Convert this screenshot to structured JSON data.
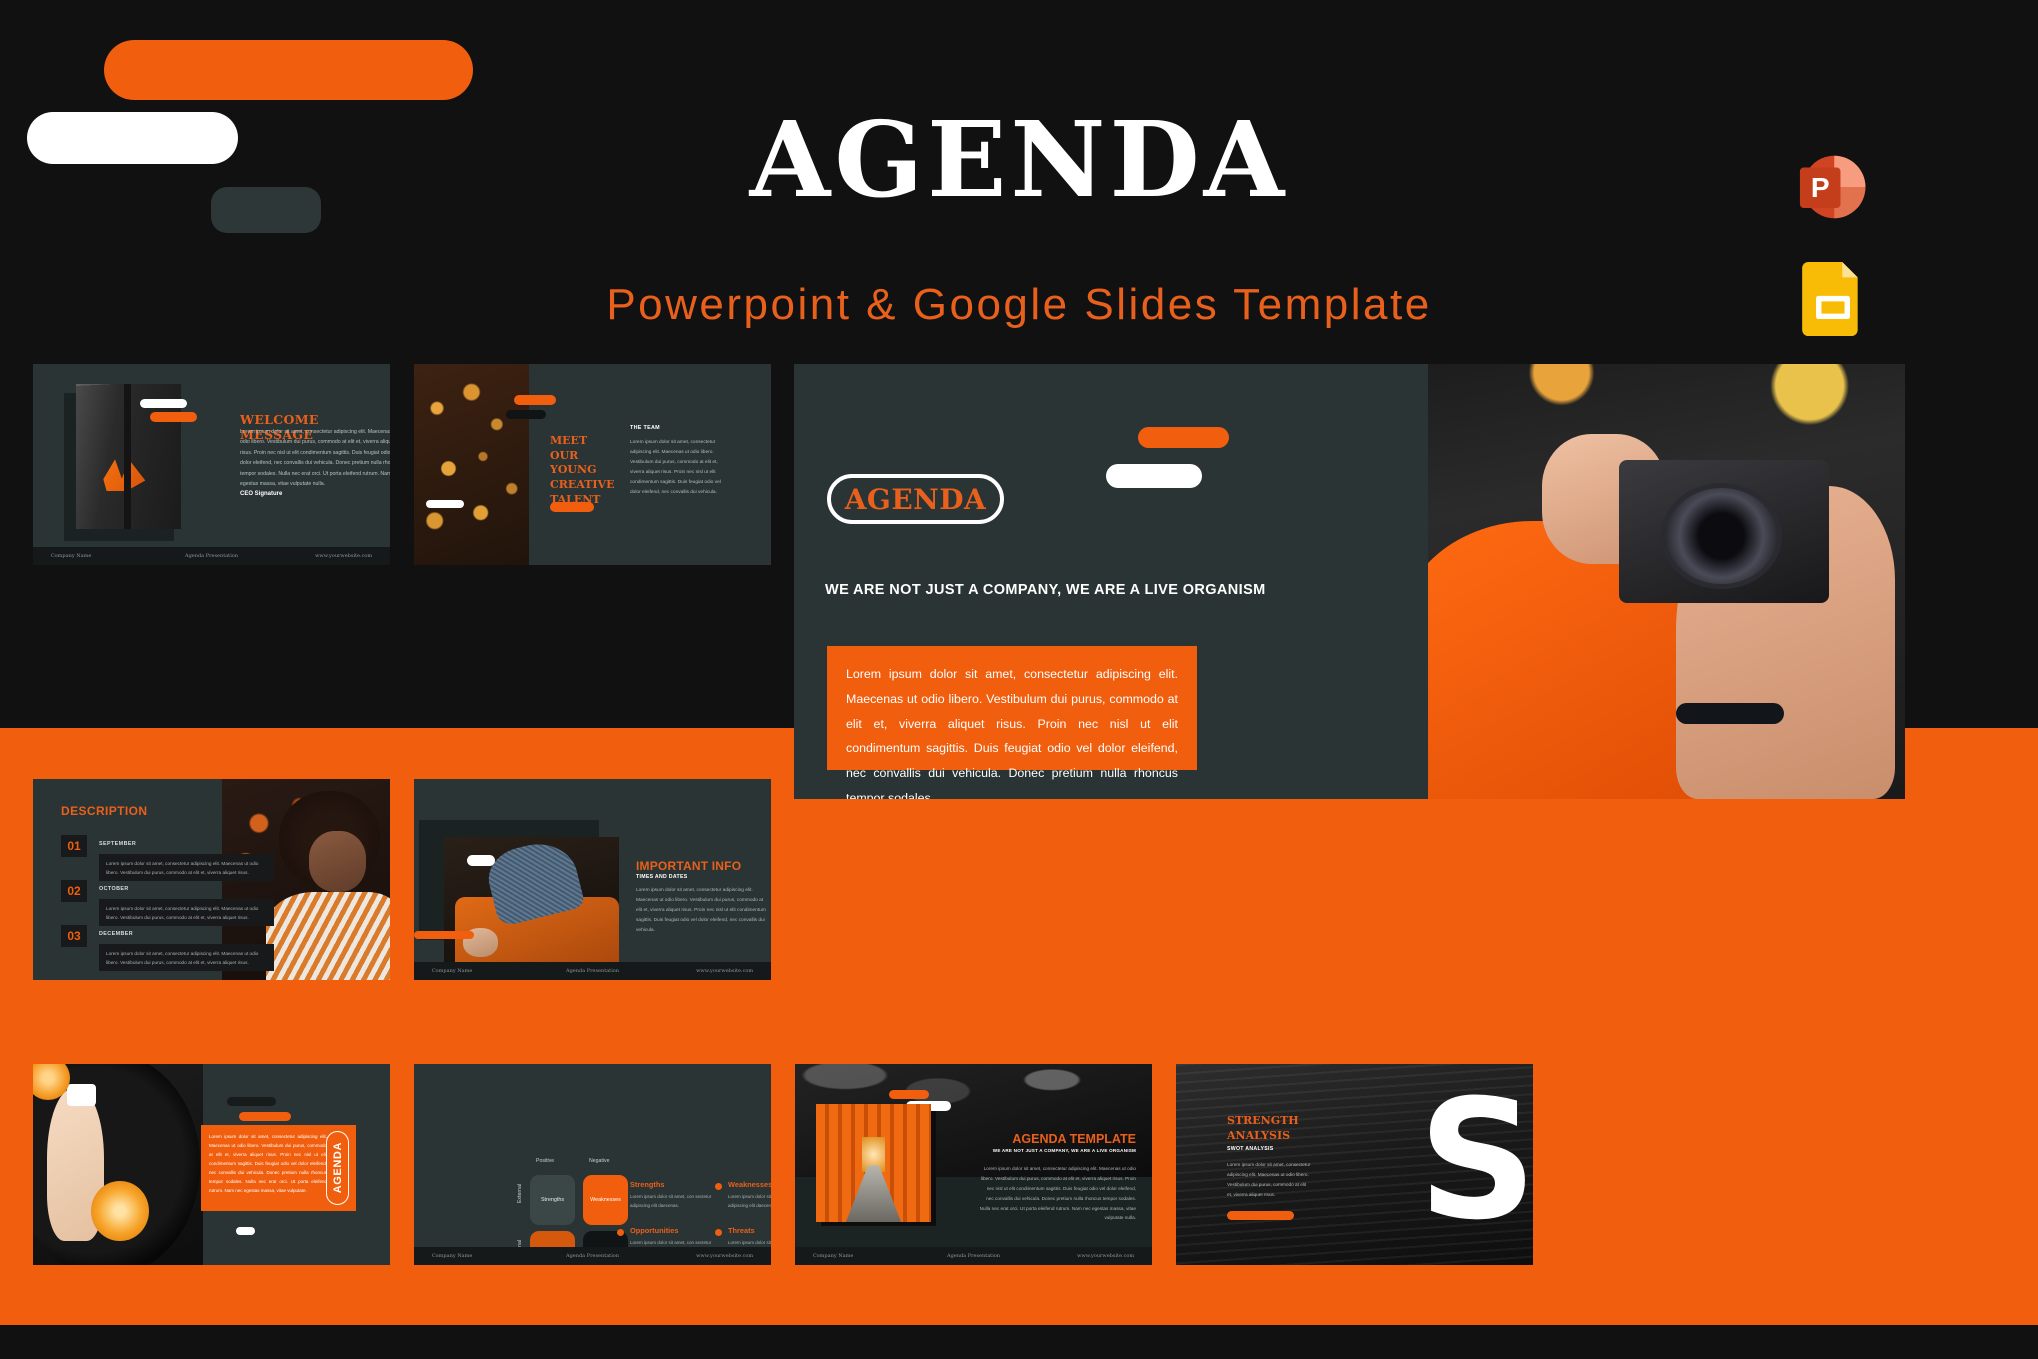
{
  "header": {
    "title": "AGENDA",
    "subtitle": "Powerpoint & Google Slides Template",
    "icons": {
      "powerpoint": "powerpoint-icon",
      "google_slides": "google-slides-icon",
      "powerpoint_letter": "P"
    }
  },
  "theme": {
    "orange": "#F05E0E",
    "orange_text": "#E8601C",
    "slide_bg": "#2A3434",
    "page_bg": "#111111",
    "footer_bg": "#15191A",
    "white": "#FFFFFF"
  },
  "footer": {
    "left": "Company Name",
    "middle": "Agenda Presentation",
    "right": "www.yourwebsite.com"
  },
  "lorem": {
    "long": "Lorem ipsum dolor sit amet, consectetur adipiscing elit. Maecenas ut odio libero. Vestibulum dui purus, commodo at elit et, viverra aliquet risus. Proin nec nisl ut elit condimentum sagittis. Duis feugiat odio vel dolor eleifend, nec convallis dui vehicula. Donec pretium nulla rhoncus tempor sodales. Nulla nec erat orci. Ut porta eleifend rutrum. Nam nec egestas massa, vitae vulputate nulla.",
    "medium": "Lorem ipsum dolor sit amet, consectetur adipiscing elit. Maecenas ut odio libero. Vestibulum dui purus, commodo at elit et, viverra aliquet risus. Proin nec nisl ut elit condimentum sagittis. Duis feugiat odio vel dolor eleifend, nec convallis dui vehicula.",
    "short": "Lorem ipsum dolor sit amet, consectetur adipiscing elit. Maecenas ut odio libero. Vestibulum dui purus, commodo at elit et, viverra aliquet risus.",
    "tiny": "Lorem ipsum dolor sit amet, con sectetur adipiscing elit daecenas.",
    "strength": "Lorem ipsum dolor sit amet, consectetur adipiscing elit. Maecenas ut odio libero. Vestibulum dui purus, commodo at elit et, viverra aliquet risus.",
    "card": "Lorem ipsum dolor sit amet, consectetur adipiscing elit. Maecenas ut odio libero. Vestibulum dui purus, commodo at elit et, viverra aliquet risus. Proin nec nisl ut elit condimentum sagittis. Duis feugiat odio vel dolor eleifend, nec convallis dui vehicula. Donec pretium nulla rhoncus tempor sodales. Nulla nec erat orci. Ut porta eleifend rutrum. Nam nec egestas massa, vitae vulputate.",
    "featured": "Lorem ipsum dolor sit amet, consectetur adipiscing elit. Maecenas ut odio libero. Vestibulum dui purus, commodo at elit et, viverra aliquet risus. Proin nec nisl ut elit condimentum sagittis. Duis feugiat odio vel dolor eleifend, nec convallis dui vehicula. Donec pretium nulla rhoncus tempor sodales."
  },
  "slides": {
    "welcome": {
      "heading": "WELCOME MESSAGE",
      "signature": "CEO Signature"
    },
    "team": {
      "heading": "MEET OUR YOUNG CREATIVE TALENT",
      "kicker": "THE TEAM"
    },
    "featured": {
      "badge": "AGENDA",
      "tagline": "WE ARE NOT JUST A COMPANY, WE ARE A LIVE ORGANISM"
    },
    "description": {
      "heading": "DESCRIPTION",
      "rows": [
        {
          "num": "01",
          "month": "SEPTEMBER"
        },
        {
          "num": "02",
          "month": "OCTOBER"
        },
        {
          "num": "03",
          "month": "DECEMBER"
        }
      ]
    },
    "important": {
      "heading": "IMPORTANT INFO",
      "kicker": "TIMES AND DATES"
    },
    "orange_card": {
      "vertical_label": "AGENDA"
    },
    "swot": {
      "col_positive": "Positive",
      "col_negative": "Negative",
      "row_external": "External",
      "row_internal": "Internal",
      "cells": {
        "strengths": "Strengths",
        "weaknesses": "Weaknesses",
        "opportunities": "Opportunities",
        "threats": "Threats"
      },
      "items": [
        {
          "title": "Strengths"
        },
        {
          "title": "Weaknesses"
        },
        {
          "title": "Opportunities"
        },
        {
          "title": "Threats"
        }
      ]
    },
    "agenda_template": {
      "heading": "AGENDA TEMPLATE",
      "tagline": "WE ARE NOT JUST A COMPANY, WE ARE A LIVE ORGANISM"
    },
    "strength": {
      "heading": "STRENGTH ANALYSIS",
      "kicker": "SWOT ANALYSIS",
      "big_letter": "S"
    }
  }
}
